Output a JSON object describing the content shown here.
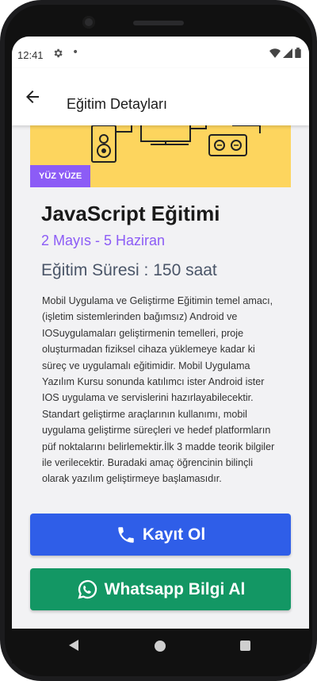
{
  "status_bar": {
    "time": "12:41"
  },
  "app_bar": {
    "title": "Eğitim Detayları"
  },
  "course": {
    "badge": "YÜZ YÜZE",
    "title": "JavaScript Eğitimi",
    "date_range": "2 Mayıs - 5 Haziran",
    "duration": "Eğitim Süresi : 150 saat",
    "description": "Mobil Uygulama ve Geliştirme Eğitimin temel amacı, (işletim sistemlerinden bağımsız) Android ve IOSuygulamaları geliştirmenin temelleri, proje oluşturmadan fiziksel cihaza yüklemeye kadar ki süreç ve uygulamalı eğitimidir. Mobil Uygulama Yazılım Kursu sonunda katılımcı ister Android ister IOS uygulama ve servislerini hazırlayabilecektir. Standart geliştirme araçlarının kullanımı, mobil uygulama geliştirme süreçleri ve hedef platformların püf noktalarını belirlemektir.İlk 3 madde teorik bilgiler ile verilecektir. Buradaki amaç öğrencinin bilinçli olarak yazılım geliştirmeye başlamasıdır."
  },
  "buttons": {
    "register_label": "Kayıt Ol",
    "whatsapp_label": "Whatsapp Bilgi Al"
  },
  "icons": {
    "back": "arrow-left-icon",
    "settings": "gear-icon",
    "wifi": "wifi-icon",
    "signal": "signal-icon",
    "battery": "battery-icon",
    "phone": "phone-icon",
    "whatsapp": "whatsapp-icon"
  },
  "colors": {
    "accent_purple": "#8c5cf6",
    "hero_yellow": "#fdd55e",
    "register_blue": "#2f5ee8",
    "whatsapp_green": "#139764"
  }
}
